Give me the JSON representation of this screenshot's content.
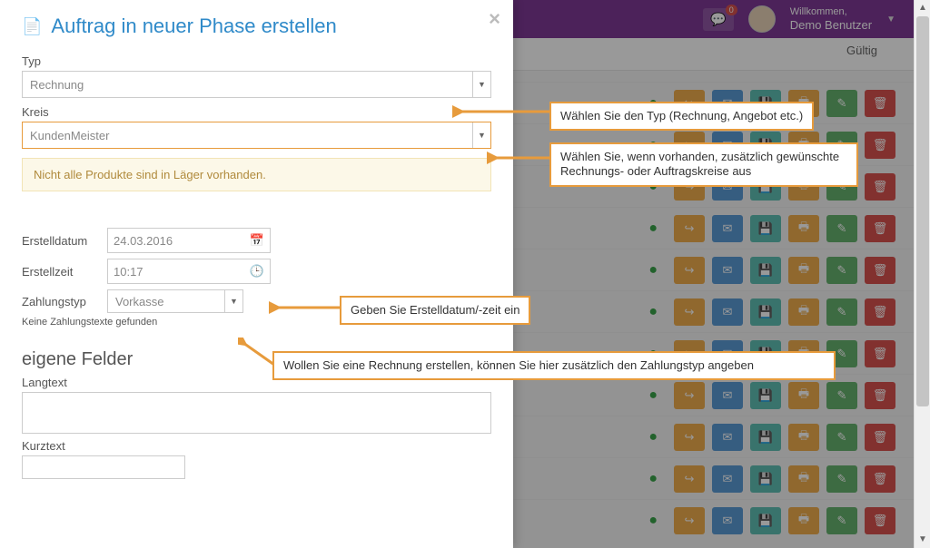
{
  "topbar": {
    "chat_count": "0",
    "welcome_small": "Willkommen,",
    "welcome_user": "Demo Benutzer"
  },
  "subhead": {
    "tab_valid": "Gültig"
  },
  "row_icons": {
    "share": "share-icon",
    "mail": "mail-icon",
    "save": "floppy-icon",
    "print": "print-icon",
    "edit": "edit-icon",
    "delete": "trash-icon"
  },
  "modal": {
    "title": "Auftrag in neuer Phase erstellen",
    "label_typ": "Typ",
    "value_typ": "Rechnung",
    "label_kreis": "Kreis",
    "value_kreis": "KundenMeister",
    "warning": "Nicht alle Produkte sind in Läger vorhanden.",
    "label_erstelldatum": "Erstelldatum",
    "value_erstelldatum": "24.03.2016",
    "label_erstellzeit": "Erstellzeit",
    "value_erstellzeit": "10:17",
    "label_zahlungstyp": "Zahlungstyp",
    "value_zahlungstyp": "Vorkasse",
    "note_zahlung": "Keine Zahlungstexte gefunden",
    "section_eigene": "eigene Felder",
    "label_langtext": "Langtext",
    "label_kurztext": "Kurztext"
  },
  "annot": {
    "typ": "Wählen Sie den Typ (Rechnung, Angebot etc.)",
    "kreis": "Wählen Sie, wenn vorhanden, zusätzlich gewünschte Rechnungs- oder Auftragskreise aus",
    "datum": "Geben Sie Erstelldatum/-zeit ein",
    "zahlung": "Wollen Sie eine Rechnung erstellen, können Sie hier zusätzlich den Zahlungstyp angeben"
  }
}
